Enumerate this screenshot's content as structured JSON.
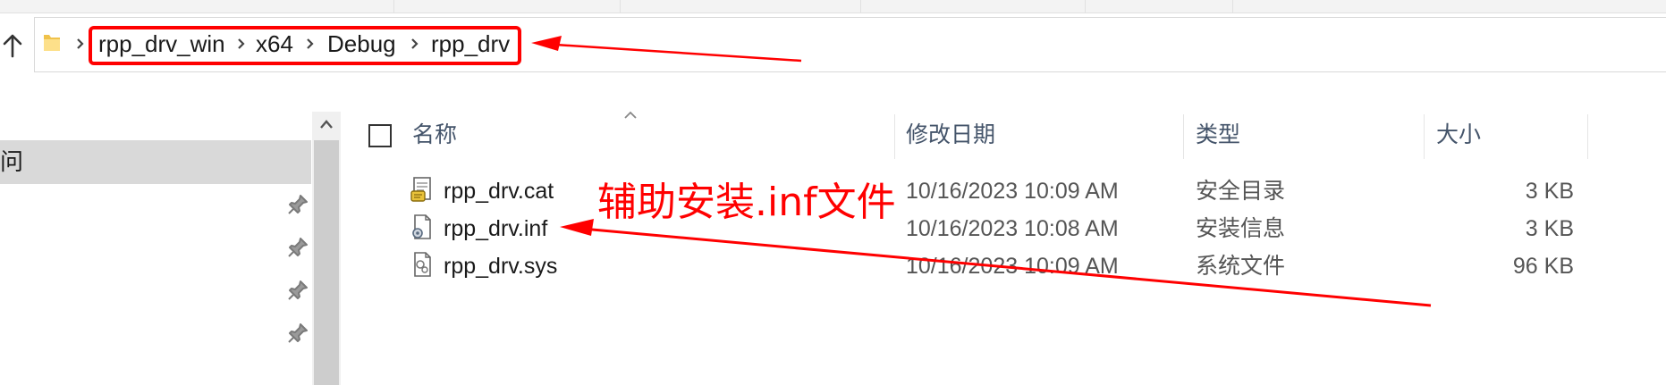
{
  "navigation": {
    "up_icon": "arrow-up-icon",
    "folder_icon": "folder-icon",
    "breadcrumbs": [
      "rpp_drv_win",
      "x64",
      "Debug",
      "rpp_drv"
    ]
  },
  "columns": {
    "name": "名称",
    "date_modified": "修改日期",
    "type": "类型",
    "size": "大小"
  },
  "files": [
    {
      "name": "rpp_drv.cat",
      "date": "10/16/2023 10:09 AM",
      "type": "安全目录",
      "size": "3 KB",
      "icon": "security-catalog-icon"
    },
    {
      "name": "rpp_drv.inf",
      "date": "10/16/2023 10:08 AM",
      "type": "安装信息",
      "size": "3 KB",
      "icon": "setup-information-icon"
    },
    {
      "name": "rpp_drv.sys",
      "date": "10/16/2023 10:09 AM",
      "type": "系统文件",
      "size": "96 KB",
      "icon": "system-file-icon"
    }
  ],
  "left_pane": {
    "selected_glyph": "问",
    "pin_icon": "pin-icon"
  },
  "annotation": {
    "note": "辅助安装.inf文件",
    "color": "#ff0000"
  }
}
